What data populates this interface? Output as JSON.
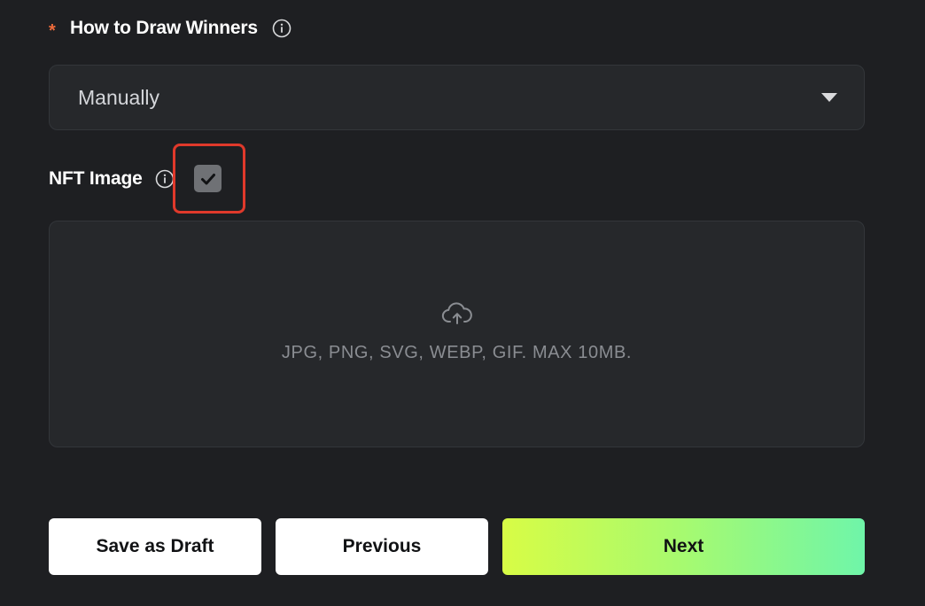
{
  "draw_winners": {
    "required_mark": "*",
    "label": "How to Draw Winners",
    "selected_value": "Manually"
  },
  "nft_image": {
    "label": "NFT Image",
    "checked": true,
    "upload_hint": "JPG, PNG, SVG, WEBP, GIF. MAX 10MB."
  },
  "actions": {
    "save_draft_label": "Save as Draft",
    "previous_label": "Previous",
    "next_label": "Next"
  },
  "colors": {
    "background": "#1e1f22",
    "field_background": "#26282b",
    "required_star": "#ee6b3b",
    "highlight_outline": "#e0392b",
    "next_gradient_start": "#d8fc45",
    "next_gradient_end": "#6ff5a9"
  },
  "icons": {
    "info": "info-icon",
    "dropdown": "chevron-down-icon",
    "check": "checkmark-icon",
    "upload": "cloud-upload-icon"
  }
}
